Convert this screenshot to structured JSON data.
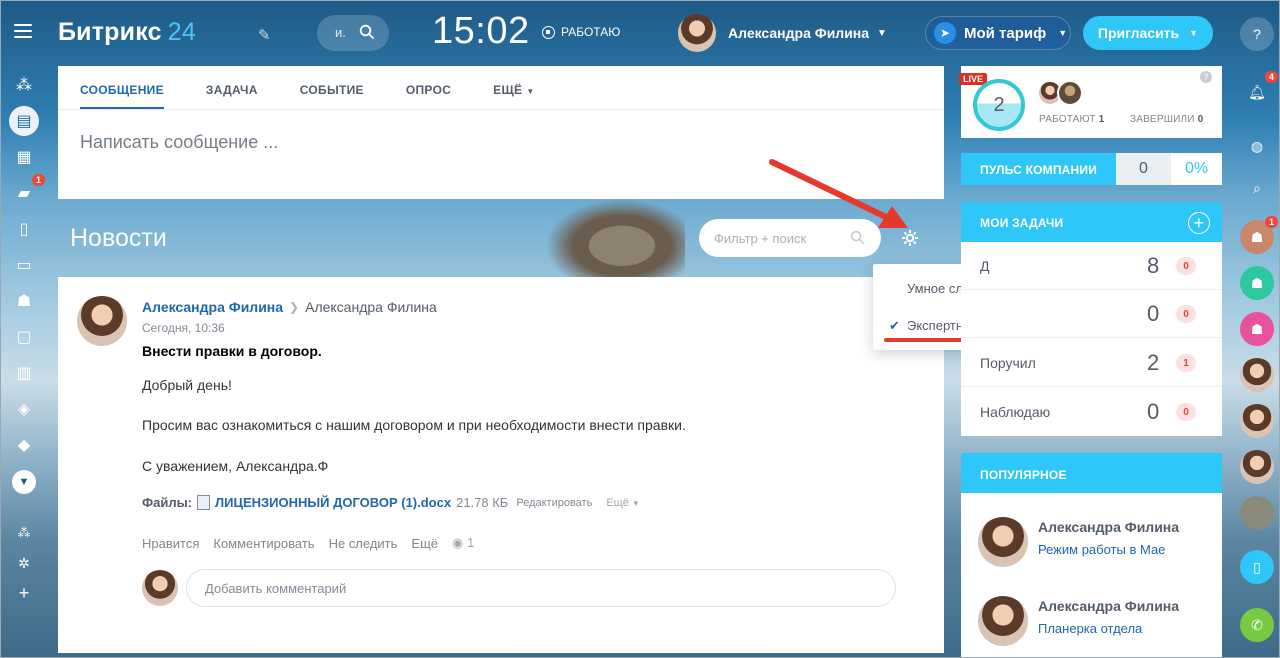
{
  "topbar": {
    "logo_main": "Битрикс",
    "logo_num": "24",
    "search_placeholder": "и.",
    "time": "15:02",
    "work_status": "РАБОТАЮ",
    "user_name": "Александра Филина",
    "tariff_label": "Мой тариф",
    "invite_label": "Пригласить"
  },
  "leftnav": {
    "chat_badge": "1"
  },
  "composer": {
    "tabs": [
      "СООБЩЕНИЕ",
      "ЗАДАЧА",
      "СОБЫТИЕ",
      "ОПРОС",
      "ЕЩЁ"
    ],
    "placeholder": "Написать сообщение ..."
  },
  "news": {
    "title": "Новости",
    "filter_placeholder": "Фильтр + поиск"
  },
  "menu": {
    "item1": "Умное слежение",
    "item2": "Экспертный режим",
    "check": "✔"
  },
  "post": {
    "author": "Александра Филина",
    "recipient": "Александра Филина",
    "date": "Сегодня, 10:36",
    "subject": "Внести правки в договор.",
    "line1": "Добрый день!",
    "line2": "Просим вас ознакомиться с нашим договором и при необходимости внести правки.",
    "line3": "С уважением, Александра.Ф",
    "files_label": "Файлы:",
    "file_name": "ЛИЦЕНЗИОННЫЙ ДОГОВОР (1).docx",
    "file_size": "21.78 КБ",
    "file_edit": "Редактировать",
    "file_more": "Ещё",
    "actions": [
      "Нравится",
      "Комментировать",
      "Не следить",
      "Ещё"
    ],
    "views": "1",
    "comment_placeholder": "Добавить комментарий"
  },
  "live": {
    "badge": "LIVE",
    "count": "2",
    "working_label": "РАБОТАЮТ",
    "working_count": "1",
    "finished_label": "ЗАВЕРШИЛИ",
    "finished_count": "0"
  },
  "pulse": {
    "label": "ПУЛЬС КОМПАНИИ",
    "value": "0",
    "percent": "0%"
  },
  "tasks": {
    "title": "МОИ ЗАДАЧИ",
    "rows": [
      {
        "name": "Д",
        "count": "8",
        "badge": "0"
      },
      {
        "name": "",
        "count": "0",
        "badge": "0"
      },
      {
        "name": "Поручил",
        "count": "2",
        "badge": "1"
      },
      {
        "name": "Наблюдаю",
        "count": "0",
        "badge": "0"
      }
    ]
  },
  "popular": {
    "title": "ПОПУЛЯРНОЕ",
    "items": [
      {
        "name": "Александра Филина",
        "text": "Режим работы в Мае"
      },
      {
        "name": "Александра Филина",
        "text": "Планерка отдела"
      }
    ]
  },
  "rbar": {
    "notif_badge": "4",
    "group_badge": "1"
  },
  "colors": {
    "accent": "#2fc7f7",
    "link": "#2067b0",
    "annotation": "#e5392e"
  }
}
